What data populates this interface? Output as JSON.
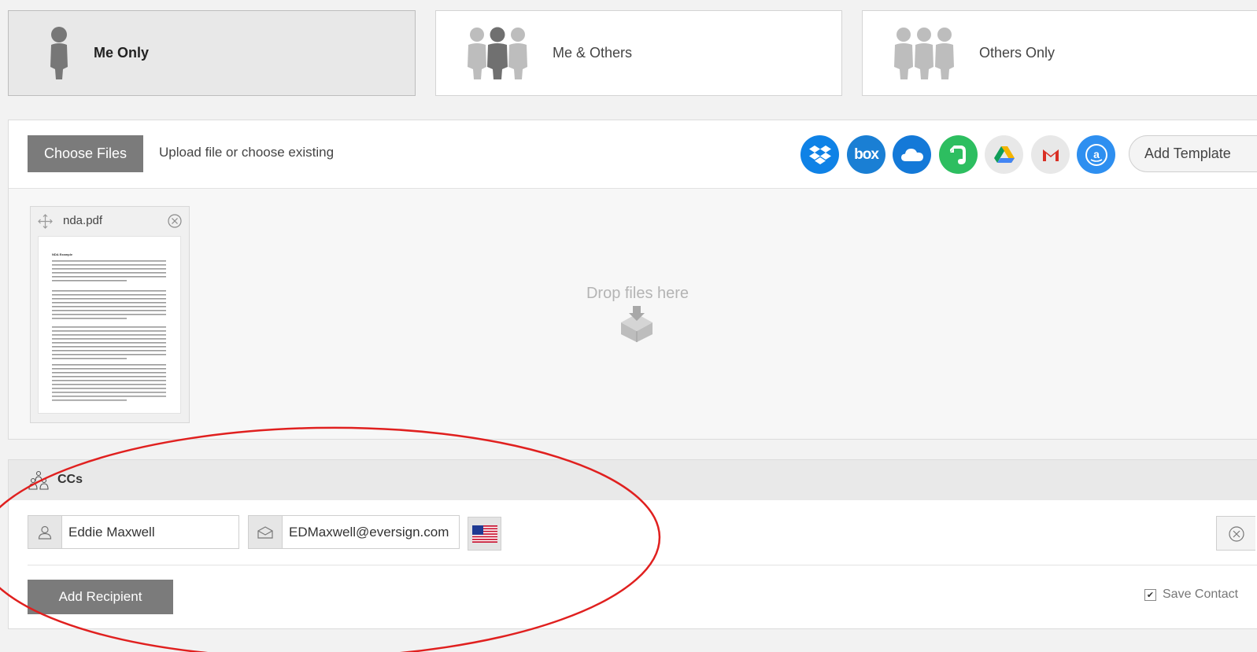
{
  "signer_types": [
    {
      "label": "Me Only",
      "selected": true,
      "icon": "single-person-icon"
    },
    {
      "label": "Me & Others",
      "selected": false,
      "icon": "group-people-icon"
    },
    {
      "label": "Others Only",
      "selected": false,
      "icon": "others-people-icon"
    }
  ],
  "upload": {
    "choose_files_label": "Choose Files",
    "hint": "Upload file or choose existing",
    "services": [
      {
        "name": "dropbox-icon",
        "color": "#0f82e6"
      },
      {
        "name": "box-icon",
        "color": "#1a7fd4"
      },
      {
        "name": "onedrive-icon",
        "color": "#1479d8"
      },
      {
        "name": "evernote-icon",
        "color": "#2dbe60"
      },
      {
        "name": "google-drive-icon",
        "color": "#e8e8e8"
      },
      {
        "name": "gmail-icon",
        "color": "#e8e8e8"
      },
      {
        "name": "amazon-icon",
        "color": "#2e8ff0"
      }
    ],
    "add_template_label": "Add Template",
    "drop_text": "Drop files here"
  },
  "file": {
    "name": "nda.pdf",
    "preview_heading": "NDA Example"
  },
  "ccs": {
    "title": "CCs",
    "recipient": {
      "name": "Eddie Maxwell",
      "email": "EDMaxwell@eversign.com"
    },
    "add_recipient_label": "Add Recipient",
    "save_contact_label": "Save Contact",
    "save_contact_checked": true
  }
}
